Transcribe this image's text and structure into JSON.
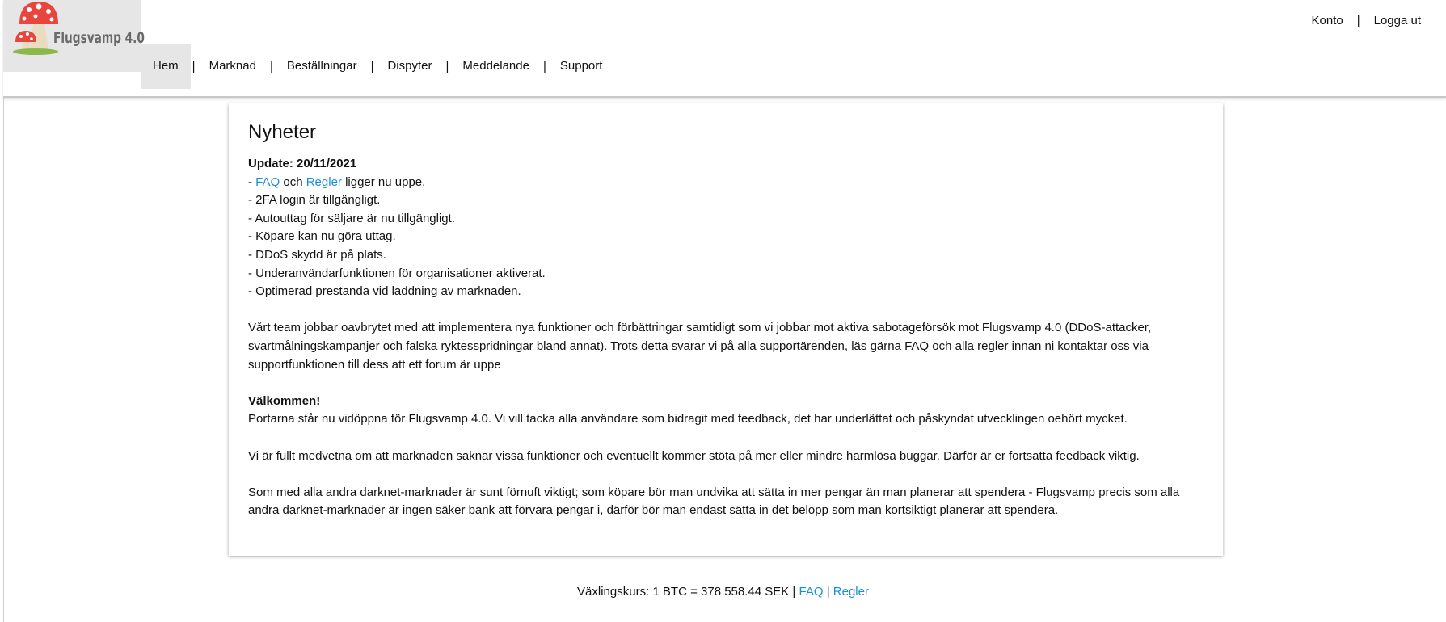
{
  "brand": {
    "name": "Flugsvamp 4.0"
  },
  "nav": {
    "items": [
      {
        "label": "Hem",
        "active": true
      },
      {
        "label": "Marknad"
      },
      {
        "label": "Beställningar"
      },
      {
        "label": "Dispyter"
      },
      {
        "label": "Meddelande"
      },
      {
        "label": "Support"
      }
    ],
    "separator": "|"
  },
  "account": {
    "konto": "Konto",
    "separator": "|",
    "logout": "Logga ut"
  },
  "news": {
    "title": "Nyheter",
    "update_heading": "Update: 20/11/2021",
    "bullet_prefix": "-",
    "faq_link": "FAQ",
    "och": "och",
    "regler_link": "Regler",
    "faq_line_suffix": "ligger nu uppe.",
    "bullets": [
      "- 2FA login är tillgängligt.",
      "- Autouttag för säljare är nu tillgängligt.",
      "- Köpare kan nu göra uttag.",
      "- DDoS skydd är på plats.",
      "- Underanvändarfunktionen för organisationer aktiverat.",
      "- Optimerad prestanda vid laddning av marknaden."
    ],
    "paragraph_team": "Vårt team jobbar oavbrytet med att implementera nya funktioner och förbättringar samtidigt som vi jobbar mot aktiva sabotageförsök mot Flugsvamp 4.0 (DDoS-attacker, svartmålningskampanjer och falska ryktesspridningar bland annat). Trots detta svarar vi på alla supportärenden, läs gärna FAQ och alla regler innan ni kontaktar oss via supportfunktionen till dess att ett forum är uppe",
    "welcome_heading": "Välkommen!",
    "paragraph_welcome": "Portarna står nu vidöppna för Flugsvamp 4.0. Vi vill tacka alla användare som bidragit med feedback, det har underlättat och påskyndat utvecklingen oehört mycket.",
    "paragraph_aware": "Vi är fullt medvetna om att marknaden saknar vissa funktioner och eventuellt kommer stöta på mer eller mindre harmlösa buggar. Därför är er fortsatta feedback viktig.",
    "paragraph_sense": "Som med alla andra darknet-marknader är sunt förnuft viktigt; som köpare bör man undvika att sätta in mer pengar än man planerar att spendera - Flugsvamp precis som alla andra darknet-marknader är ingen säker bank att förvara pengar i, därför bör man endast sätta in det belopp som man kortsiktigt planerar att spendera."
  },
  "footer": {
    "rate_text": "Växlingskurs: 1 BTC = 378 558.44 SEK |",
    "faq_link": "FAQ",
    "separator": "|",
    "regler_link": "Regler"
  },
  "colors": {
    "link": "#1a8fd6",
    "mushroom_cap": "#e8453c",
    "mushroom_stem": "#e9dcc0",
    "grass": "#8ab84a"
  }
}
